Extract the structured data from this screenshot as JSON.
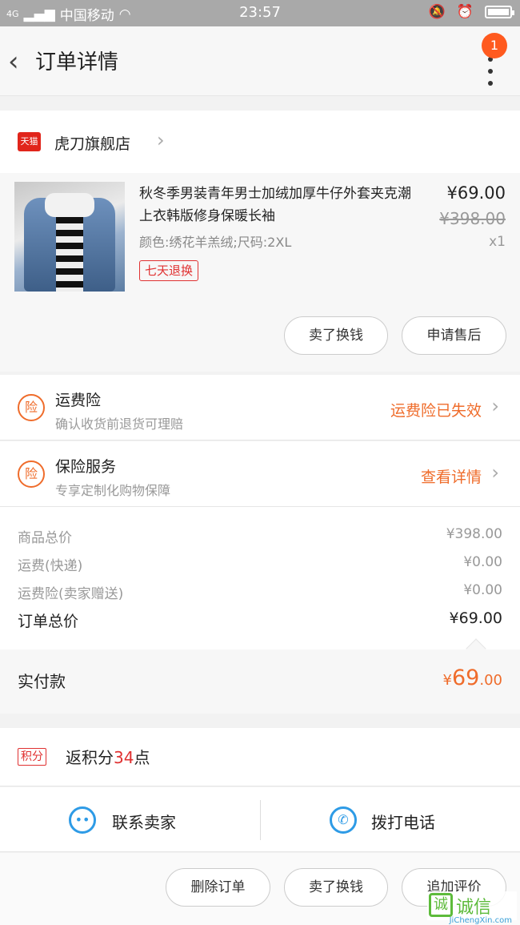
{
  "status_bar": {
    "carrier": "中国移动",
    "time": "23:57",
    "signal": "4G"
  },
  "nav": {
    "title": "订单详情",
    "badge": "1"
  },
  "store": {
    "tmall_label": "天猫",
    "name": "虎刀旗舰店"
  },
  "item": {
    "title": "秋冬季男装青年男士加绒加厚牛仔外套夹克潮上衣韩版修身保暖长袖",
    "spec": "颜色:绣花羊羔绒;尺码:2XL",
    "tag": "七天退换",
    "price": "¥69.00",
    "original_price": "¥398.00",
    "quantity": "x1",
    "btn_sell": "卖了换钱",
    "btn_aftersale": "申请售后"
  },
  "insurance": [
    {
      "icon": "险",
      "title": "运费险",
      "sub": "确认收货前退货可理赔",
      "status": "运费险已失效"
    },
    {
      "icon": "险",
      "title": "保险服务",
      "sub": "专享定制化购物保障",
      "status": "查看详情"
    }
  ],
  "summary": {
    "rows": [
      {
        "label": "商品总价",
        "value": "¥398.00"
      },
      {
        "label": "运费(快递)",
        "value": "¥0.00"
      },
      {
        "label": "运费险(卖家赠送)",
        "value": "¥0.00"
      }
    ],
    "total_label": "订单总价",
    "total_value": "¥69.00"
  },
  "payment": {
    "label": "实付款",
    "currency": "¥",
    "int": "69",
    "dec": ".00"
  },
  "points": {
    "tag": "积分",
    "prefix": "返积分",
    "value": "34",
    "suffix": "点"
  },
  "contact": {
    "seller": "联系卖家",
    "phone": "拨打电话"
  },
  "actions": {
    "delete": "删除订单",
    "sell": "卖了换钱",
    "review": "追加评价"
  },
  "watermark": {
    "text": "诚信",
    "url": "JiChengXin.com"
  },
  "colors": {
    "accent": "#ef6c2b",
    "link_blue": "#2e9be6",
    "red": "#e03131"
  }
}
